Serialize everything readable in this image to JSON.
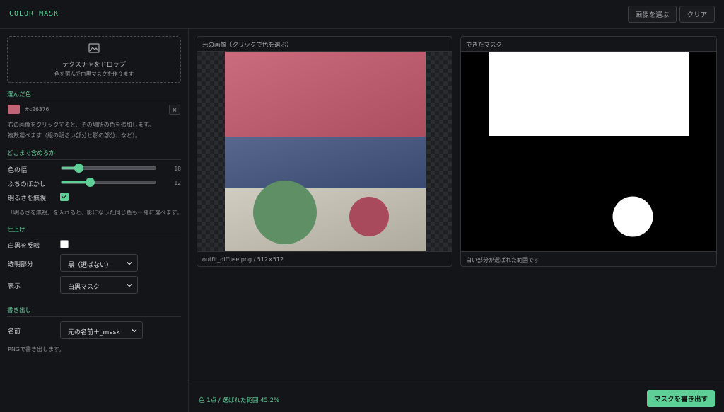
{
  "header": {
    "app_title": "COLOR MASK",
    "choose_image_label": "画像を選ぶ",
    "clear_label": "クリア"
  },
  "dropzone": {
    "icon": "image-icon",
    "title": "テクスチャをドロップ",
    "subtitle": "色を選んで白黒マスクを作ります"
  },
  "selected_colors": {
    "title": "選んだ色",
    "items": [
      {
        "hex": "#c26376",
        "color": "#c26376"
      }
    ],
    "remove_label": "×",
    "hint_line1": "右の画像をクリックすると、その場所の色を追加します。",
    "hint_line2": "複数選べます（服の明るい部分と影の部分、など）。"
  },
  "range": {
    "title": "どこまで含めるか",
    "width_label": "色の幅",
    "width_value": 18,
    "width_max": 100,
    "blur_label": "ふちのぼかし",
    "blur_value": 12,
    "blur_max": 40,
    "ignore_brightness_label": "明るさを無視",
    "ignore_brightness_checked": true,
    "hint": "「明るさを無視」を入れると、影になった同じ色も一緒に選べます。"
  },
  "finish": {
    "title": "仕上げ",
    "invert_label": "白黒を反転",
    "invert_checked": false,
    "transparent_label": "透明部分",
    "transparent_value": "黒（選ばない）",
    "display_label": "表示",
    "display_value": "白黒マスク"
  },
  "export": {
    "title": "書き出し",
    "name_label": "名前",
    "name_value": "元の名前＋_mask",
    "hint": "PNGで書き出します。"
  },
  "source_panel": {
    "title": "元の画像（クリックで色を選ぶ）",
    "caption": "outfit_diffuse.png / 512×512"
  },
  "mask_panel": {
    "title": "できたマスク",
    "caption": "白い部分が選ばれた範囲です"
  },
  "footer": {
    "status": "色 1点 / 選ばれた範囲 45.2%",
    "export_label": "マスクを書き出す"
  },
  "colors": {
    "accent": "#5fcf98",
    "band_pink": "#c26376",
    "band_blue": "#4f5f85",
    "band_cream": "#c9c4b8",
    "circle_green": "#5e8f65",
    "circle_red": "#a84a5c"
  }
}
